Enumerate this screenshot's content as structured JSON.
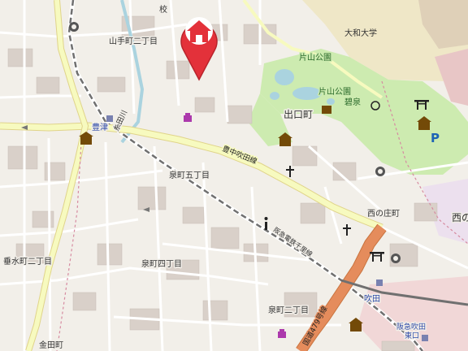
{
  "map": {
    "labels": {
      "yamatecho_2": "山手町二丁目",
      "yamatecho_tail": "目",
      "daiwa_univ": "大和大学",
      "katayama_park_n": "片山公園",
      "katayama_park_s": "片山公園",
      "hekisen": "碧泉",
      "deguchicho": "出口町",
      "toyotsu": "豊津",
      "toyotsu_river": "糸田川",
      "toyonaka_suita_line": "豊中吹田線",
      "izumicho_5": "泉町五丁目",
      "izumicho_4": "泉町四丁目",
      "izumicho_2": "泉町二丁目",
      "nishinoshocho": "西の庄町",
      "nishino_edge": "西の",
      "tarumicho_2": "垂水町二丁目",
      "kaneda": "金田町",
      "suita": "吹田",
      "hankyu_suita": "阪急吹田",
      "hankyu_suita_2": "東口",
      "hankyu_senri": "阪急電鉄千里線",
      "route479": "国道479号線",
      "top_frag": "校"
    },
    "marker": {
      "icon": "home-pin-icon",
      "color": "#e3313a"
    },
    "colors": {
      "background": "#f2efe9",
      "road_primary": "#f7fabf",
      "road_trunk": "#e58c5c",
      "park": "#cdebb0",
      "water": "#aad3df",
      "rail": "#707070",
      "building": "#d9d0c9"
    },
    "pois": [
      "shop-icon",
      "church-icon",
      "temple-icon",
      "shrine-icon",
      "info-icon",
      "parking-icon",
      "library-icon",
      "school-icon"
    ]
  }
}
